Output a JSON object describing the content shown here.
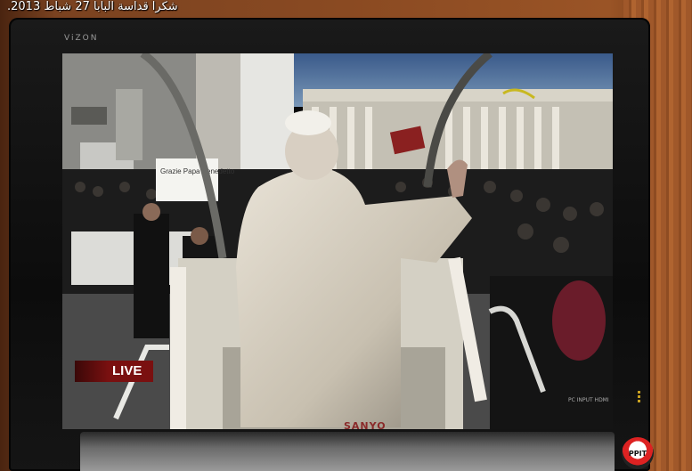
{
  "caption": "شكرا قداسة البابا 27 شباط 2013.",
  "monitor": {
    "brand_top": "ViZON",
    "brand_bottom": "SANYO",
    "ports": "PC INPUT   HDMI",
    "sticker": "PPIT"
  },
  "broadcast": {
    "badge": "LIVE",
    "sign": "Grazie Papa Benedetto"
  }
}
